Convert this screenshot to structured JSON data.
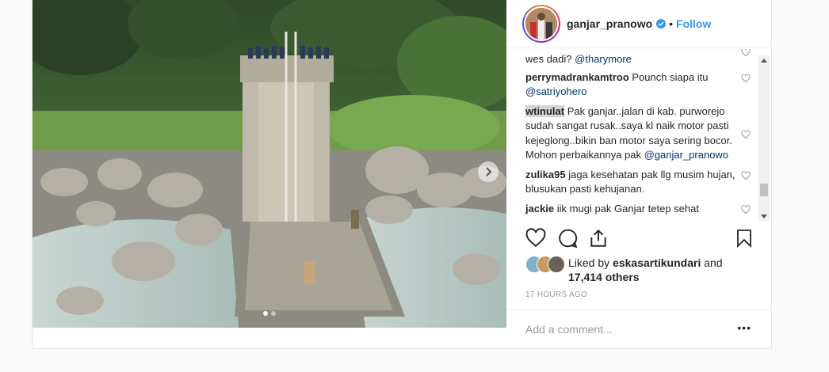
{
  "header": {
    "username": "ganjar_pranowo",
    "separator": "•",
    "follow_label": "Follow"
  },
  "comments": [
    {
      "user": "",
      "text": "wes dadi? ",
      "mention": "@tharymore"
    },
    {
      "user": "perrymadrankamtroo",
      "text": "Pounch siapa itu ",
      "mention": "@satriyohero"
    },
    {
      "user": "wtinulat",
      "text": "Pak ganjar..jalan di kab. purworejo sudah sangat rusak..saya kl naik motor pasti kejeglong..bikin ban motor saya sering bocor. Mohon perbaikannya pak ",
      "mention": "@ganjar_pranowo"
    },
    {
      "user": "zulika95",
      "text": "jaga kesehatan pak llg musim hujan, blusukan pasti kehujanan.",
      "mention": ""
    },
    {
      "user": "jackie",
      "text": "iik mugi pak Ganjar tetep sehat",
      "mention": ""
    }
  ],
  "likes": {
    "prefix": "Liked by ",
    "user": "eskasartikundari",
    "and": " and",
    "count": "17,414 others"
  },
  "timestamp": "17 HOURS AGO",
  "add_comment_placeholder": "Add a comment...",
  "more_label": "•••",
  "icons": {
    "next": "chevron-right-icon",
    "like": "heart-icon",
    "comment": "comment-icon",
    "share": "share-icon",
    "save": "bookmark-icon",
    "verified": "verified-badge-icon"
  },
  "colors": {
    "link": "#003569",
    "follow": "#3897f0",
    "verified": "#3897f0",
    "muted": "#999999"
  },
  "carousel": {
    "slides": 2,
    "active": 1
  }
}
